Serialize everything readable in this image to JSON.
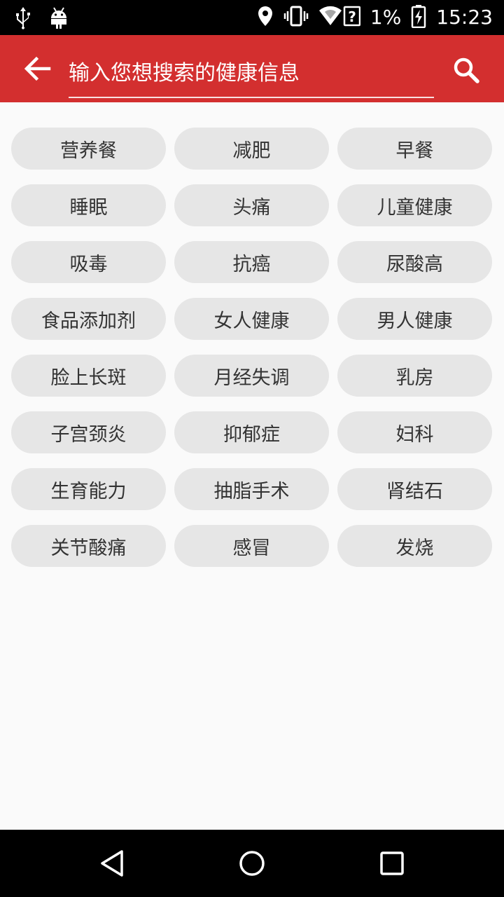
{
  "status_bar": {
    "battery_percent": "1%",
    "time": "15:23"
  },
  "search": {
    "placeholder": "输入您想搜索的健康信息",
    "value": ""
  },
  "tags": [
    "营养餐",
    "减肥",
    "早餐",
    "睡眠",
    "头痛",
    "儿童健康",
    "吸毒",
    "抗癌",
    "尿酸高",
    "食品添加剂",
    "女人健康",
    "男人健康",
    "脸上长斑",
    "月经失调",
    "乳房",
    "子宫颈炎",
    "抑郁症",
    "妇科",
    "生育能力",
    "抽脂手术",
    "肾结石",
    "关节酸痛",
    "感冒",
    "发烧"
  ],
  "colors": {
    "app_bar": "#d32f2f",
    "tag_background": "#e6e6e6",
    "tag_text": "#333333",
    "page_background": "#fafafa"
  },
  "icons": {
    "status_left": [
      "usb-icon",
      "android-debug-icon"
    ],
    "status_right": [
      "location-icon",
      "vibrate-icon",
      "wifi-unknown-icon",
      "battery-charging-icon"
    ],
    "app_bar": [
      "back-arrow-icon",
      "search-icon"
    ],
    "nav": [
      "back-triangle-icon",
      "home-circle-icon",
      "recents-square-icon"
    ]
  }
}
